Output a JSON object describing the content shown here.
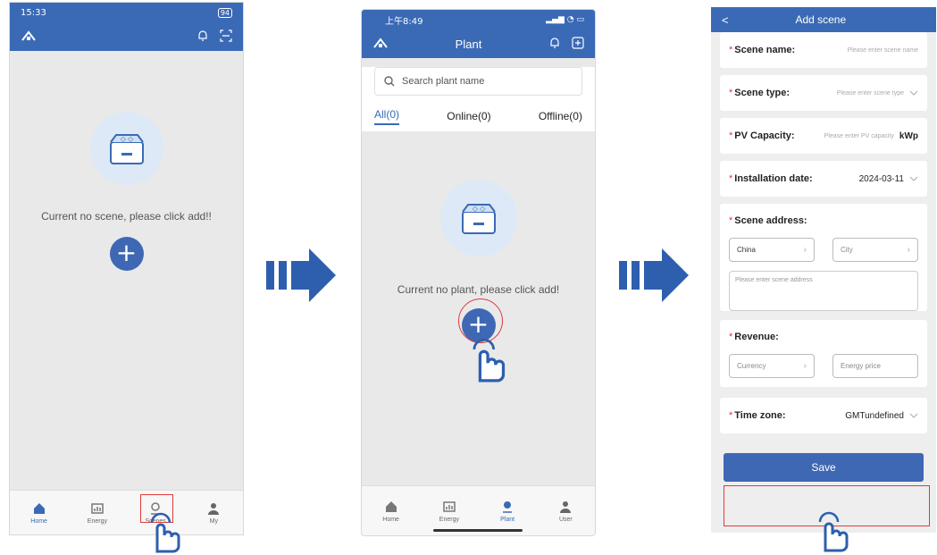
{
  "screen1": {
    "status_time": "15:33",
    "status_right": "94",
    "empty_message": "Current no scene, please click add!!",
    "add_symbol": "+",
    "nav": [
      "Home",
      "Energy",
      "Scenes",
      "My"
    ]
  },
  "screen2": {
    "status_time": "上午8:49",
    "title": "Plant",
    "search_placeholder": "Search plant name",
    "tabs": [
      "All(0)",
      "Online(0)",
      "Offline(0)"
    ],
    "empty_message": "Current no plant, please click add!",
    "add_symbol": "+",
    "nav": [
      "Home",
      "Energy",
      "Plant",
      "User"
    ]
  },
  "screen3": {
    "back_symbol": "<",
    "title": "Add scene",
    "required_mark": "*",
    "scene_name_label": "Scene name:",
    "scene_name_placeholder": "Please enter scene name",
    "scene_type_label": "Scene type:",
    "scene_type_placeholder": "Please enter scene type",
    "pv_label": "PV Capacity:",
    "pv_placeholder": "Please enter PV capacity",
    "pv_unit": "kWp",
    "install_label": "Installation date:",
    "install_value": "2024-03-11",
    "address_label": "Scene address:",
    "country": "China",
    "city_placeholder": "City",
    "address_placeholder": "Please enter scene address",
    "revenue_label": "Revenue:",
    "currency_placeholder": "Currency",
    "energy_price_placeholder": "Energy price",
    "timezone_label": "Time zone:",
    "timezone_value": "GMTundefined",
    "save_label": "Save"
  },
  "colors": {
    "brand": "#3a6ab6",
    "highlight": "#e03a3a"
  }
}
